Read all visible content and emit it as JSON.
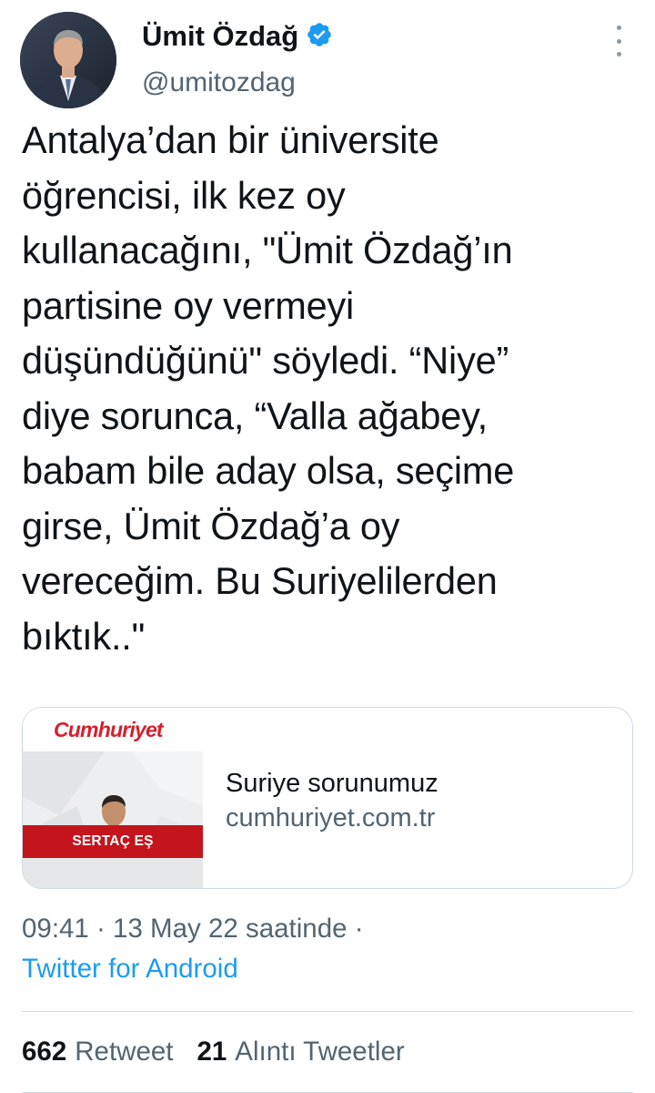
{
  "user": {
    "name": "Ümit Özdağ",
    "handle": "@umitozdag"
  },
  "tweet": {
    "text": "Antalya’dan bir üniversite\nöğrencisi, ilk kez oy\nkullanacağını, \"Ümit Özdağ’ın\npartisine oy vermeyi\ndüşündüğünü\" söyledi. “Niye”\ndiye sorunca, “Valla ağabey,\nbabam bile aday olsa, seçime\ngirse, Ümit Özdağ’a oy\nvereceğim. Bu Suriyelilerden\nbıktık..\""
  },
  "card": {
    "thumb_logo": "Cumhuriyet",
    "thumb_caption": "SERTAÇ EŞ",
    "title": "Suriye sorunumuz",
    "domain": "cumhuriyet.com.tr"
  },
  "meta": {
    "time": "09:41 · 13 May 22 saatinde ·",
    "source": "Twitter for Android"
  },
  "stats": {
    "retweet_count": "662",
    "retweet_label": "Retweet",
    "quote_count": "21",
    "quote_label": "Alıntı Tweetler"
  },
  "colors": {
    "text": "#0f1419",
    "secondary": "#536471",
    "link": "#1d9bf0",
    "verified": "#1d9bf0",
    "brand_red": "#c4141c"
  },
  "icons": {
    "verified": "verified-badge-icon",
    "more": "more-vertical-icon"
  }
}
